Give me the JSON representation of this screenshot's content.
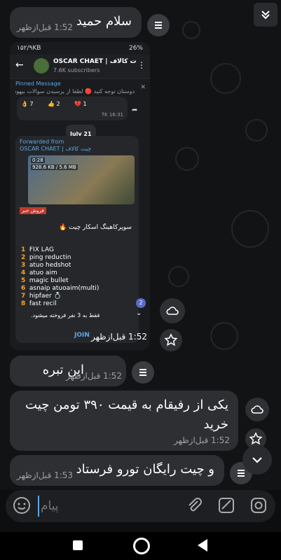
{
  "messages": [
    {
      "text": "سلام حمید",
      "time": "1:52 قبل‌ازظهر"
    },
    {
      "text": "این تبره",
      "time": "1:52 قبل‌ازظهر"
    },
    {
      "text_line1": "یکی از رفیقام به قیمت ۳۹۰ تومن چیت",
      "text_line2": "خرید",
      "time": "1:52 قبل‌ازظهر"
    },
    {
      "text": "و چیت رایگان تورو فرستاد",
      "time": "1:53 قبل‌ازظهر"
    }
  ],
  "image_message": {
    "time": "1:52 قبل‌ازظهر"
  },
  "screenshot": {
    "status_left": "۱۵۲/۹KB",
    "status_right": "26%",
    "channel_name": "OSCAR CHAET | ت کالاف",
    "subscribers": "7.6K subscribers",
    "pinned_label": "Pinned Message",
    "pinned_text": "دوستان توجه کنید 🔴 لطفا از پرسیدن سوالات بیهوده",
    "reactions": [
      "👌 7",
      "👍 2",
      "💔 1"
    ],
    "views": "7K 16:31",
    "date_chip": "July 21",
    "forwarded": "Forwarded from",
    "forward_source": "OSCAR CHAET | چیت کالاف",
    "video_time": "0:28",
    "video_size": "928.6 KB / 5.6 MB",
    "tag": "فروش خبر",
    "headline": "سوپرکاهینگ اسکار چیت 🔥",
    "features": [
      {
        "n": "1",
        "t": "FIX LAG"
      },
      {
        "n": "2",
        "t": "ping reductin"
      },
      {
        "n": "3",
        "t": "atuo hedshot"
      },
      {
        "n": "4",
        "t": "atuo aim"
      },
      {
        "n": "5",
        "t": "magic bullet"
      },
      {
        "n": "6",
        "t": "asnaip atuoaim(multi)"
      },
      {
        "n": "7",
        "t": "hipfaer 💍"
      },
      {
        "n": "8",
        "t": "fast recil"
      }
    ],
    "footer_note": "فقط به 3 نفر فروخته میشود.",
    "unread_badge": "2",
    "join_label": "JOIN"
  },
  "input": {
    "placeholder": "پیام"
  },
  "colors": {
    "bubble": "#2e2f33",
    "background": "#121315",
    "accent": "#5aa9e6"
  }
}
